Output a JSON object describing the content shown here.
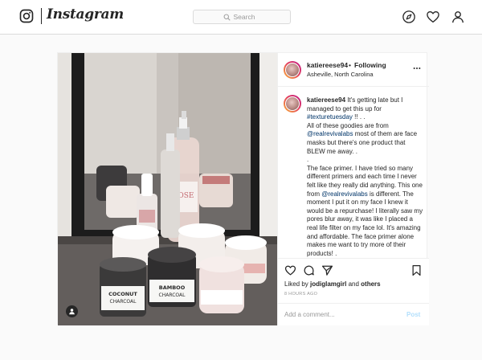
{
  "nav": {
    "wordmark": "Instagram",
    "search_placeholder": "Search",
    "icons": [
      "instagram-logo-icon",
      "search-icon",
      "explore-compass-icon",
      "activity-heart-icon",
      "profile-person-icon"
    ]
  },
  "post": {
    "author": {
      "username": "katiereese94",
      "separator": "•",
      "follow_status": "Following",
      "location": "Asheville, North Carolina"
    },
    "photo": {
      "jar_labels": [
        "ROSE",
        "COCONUT",
        "CHARCOAL",
        "BAMBOO",
        "CHARCOAL"
      ]
    },
    "caption": {
      "username": "katiereese94",
      "p1_a": " It's getting late but I managed to get this up for ",
      "hashtag": "#texturetuesday",
      "p1_b": " !! . .",
      "p2_a": "All of these goodies are from ",
      "mention1": "@realrevivalabs",
      "p2_b": " most of them are face masks but there's one product that BLEW me away. .",
      "p3": ".",
      "p4_a": "The face primer. I have tried so many different primers and each time I never felt like they really did anything. This one from ",
      "mention2": "@realrevivalabs",
      "p4_b": " is different. The moment I put it on my face I knew it would be a repurchase! I literally saw my pores blur away, it was like I placed a real life filter on my face lol. It's amazing and affordable. The face primer alone makes me want to try more of their products! ."
    },
    "likes": {
      "prefix": "Liked by ",
      "user": "jodiglamgirl",
      "middle": " and ",
      "others": "others"
    },
    "timestamp": "8 HOURS AGO",
    "comment": {
      "placeholder": "Add a comment...",
      "post_label": "Post"
    }
  },
  "colors": {
    "link": "#003569",
    "post_button_disabled": "#b2dffc",
    "border": "#dbdbdb",
    "muted": "#999999",
    "text": "#262626"
  }
}
